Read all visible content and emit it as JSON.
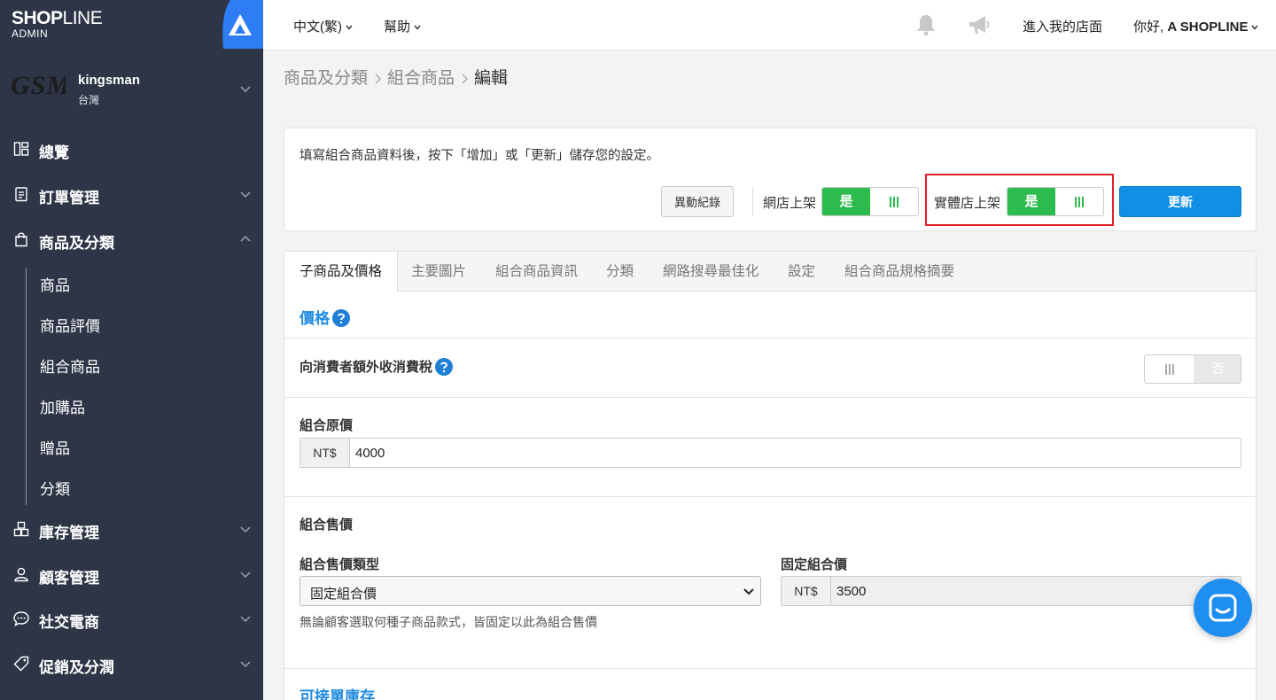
{
  "brand": {
    "name_bold": "SHOP",
    "name_light": "LINE",
    "sub": "ADMIN"
  },
  "shop": {
    "logo_text": "GSM",
    "name": "kingsman",
    "region": "台灣"
  },
  "nav": {
    "overview": "總覽",
    "orders": "訂單管理",
    "products": "商品及分類",
    "sub": [
      "商品",
      "商品評價",
      "組合商品",
      "加購品",
      "贈品",
      "分類"
    ],
    "inventory": "庫存管理",
    "customers": "顧客管理",
    "social": "社交電商",
    "promotions": "促銷及分潤"
  },
  "topbar": {
    "language": "中文(繁)",
    "help": "幫助",
    "enter_store": "進入我的店面",
    "greeting_prefix": "你好, ",
    "greeting_name": "A SHOPLINE"
  },
  "breadcrumb": {
    "level1": "商品及分類",
    "level2": "組合商品",
    "current": "編輯"
  },
  "panel1": {
    "note": "填寫組合商品資料後，按下「增加」或「更新」儲存您的設定。",
    "log_button": "異動紀錄",
    "online_label": "網店上架",
    "online_yes": "是",
    "offline_label": "實體店上架",
    "offline_yes": "是",
    "update_button": "更新"
  },
  "tabs": [
    "子商品及價格",
    "主要圖片",
    "組合商品資訊",
    "分類",
    "網路搜尋最佳化",
    "設定",
    "組合商品規格摘要"
  ],
  "price": {
    "title": "價格",
    "tax_label": "向消費者額外收消費稅",
    "tax_no": "否",
    "original_label": "組合原價",
    "currency": "NT$",
    "original_value": "4000",
    "sale_label": "組合售價",
    "sale_type_label": "組合售價類型",
    "sale_type_value": "固定組合價",
    "fixed_label": "固定組合價",
    "fixed_currency": "NT$",
    "fixed_value": "3500",
    "hint": "無論顧客選取何種子商品款式，皆固定以此為組合售價"
  },
  "stock": {
    "title": "可接單庫存"
  },
  "colors": {
    "sidebar": "#2d3547",
    "accent": "#1f8be0",
    "toggle_on": "#2dbb4e",
    "highlight": "#e0202a"
  }
}
